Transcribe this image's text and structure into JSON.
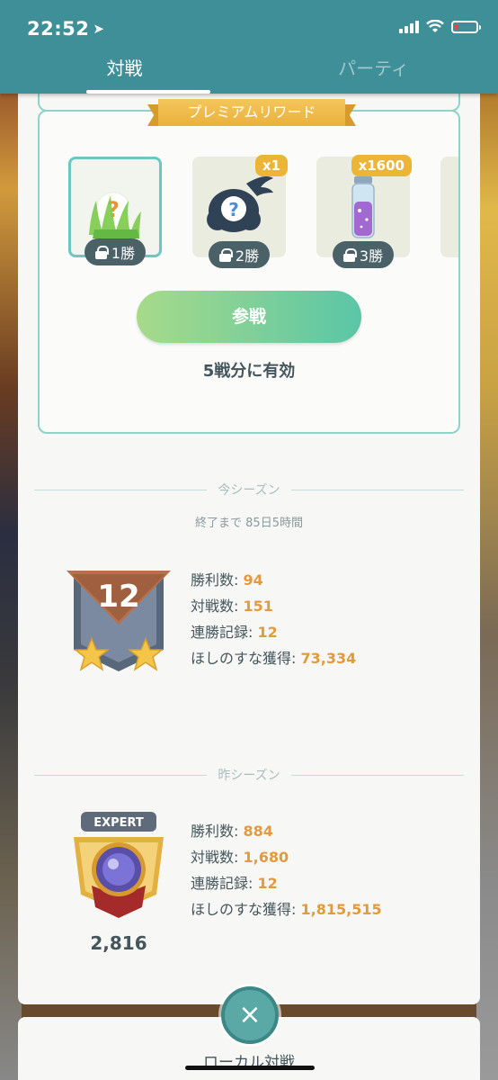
{
  "status_bar": {
    "time": "22:52"
  },
  "tabs": [
    {
      "label": "対戦",
      "active": true
    },
    {
      "label": "パーティ",
      "active": false
    }
  ],
  "premium_reward": {
    "title": "プレミアムリワード",
    "items": [
      {
        "icon": "mystery-grass-icon",
        "wins_label": "1勝"
      },
      {
        "icon": "mystery-cloud-icon",
        "qty_label": "x1",
        "wins_label": "2勝"
      },
      {
        "icon": "stardust-bottle-icon",
        "qty_label": "x1600",
        "wins_label": "3勝"
      }
    ],
    "join_button": "参戦",
    "valid_text": "5戦分に有効"
  },
  "current_season": {
    "label": "今シーズン",
    "remaining": "終了まで 85日5時間",
    "rank": "12",
    "stats": [
      {
        "label": "勝利数:",
        "value": "94"
      },
      {
        "label": "対戦数:",
        "value": "151"
      },
      {
        "label": "連勝記録:",
        "value": "12"
      },
      {
        "label": "ほしのすな獲得:",
        "value": "73,334"
      }
    ]
  },
  "previous_season": {
    "label": "昨シーズン",
    "badge_label": "EXPERT",
    "rating": "2,816",
    "stats": [
      {
        "label": "勝利数:",
        "value": "884"
      },
      {
        "label": "対戦数:",
        "value": "1,680"
      },
      {
        "label": "連勝記録:",
        "value": "12"
      },
      {
        "label": "ほしのすな獲得:",
        "value": "1,815,515"
      }
    ]
  },
  "bottom": {
    "local_battle": "ローカル対戦"
  },
  "colors": {
    "header": "#3f8f99",
    "accent_teal": "#8fd2cc",
    "stat_value": "#e49a3c",
    "badge_gold": "#ecb535"
  }
}
